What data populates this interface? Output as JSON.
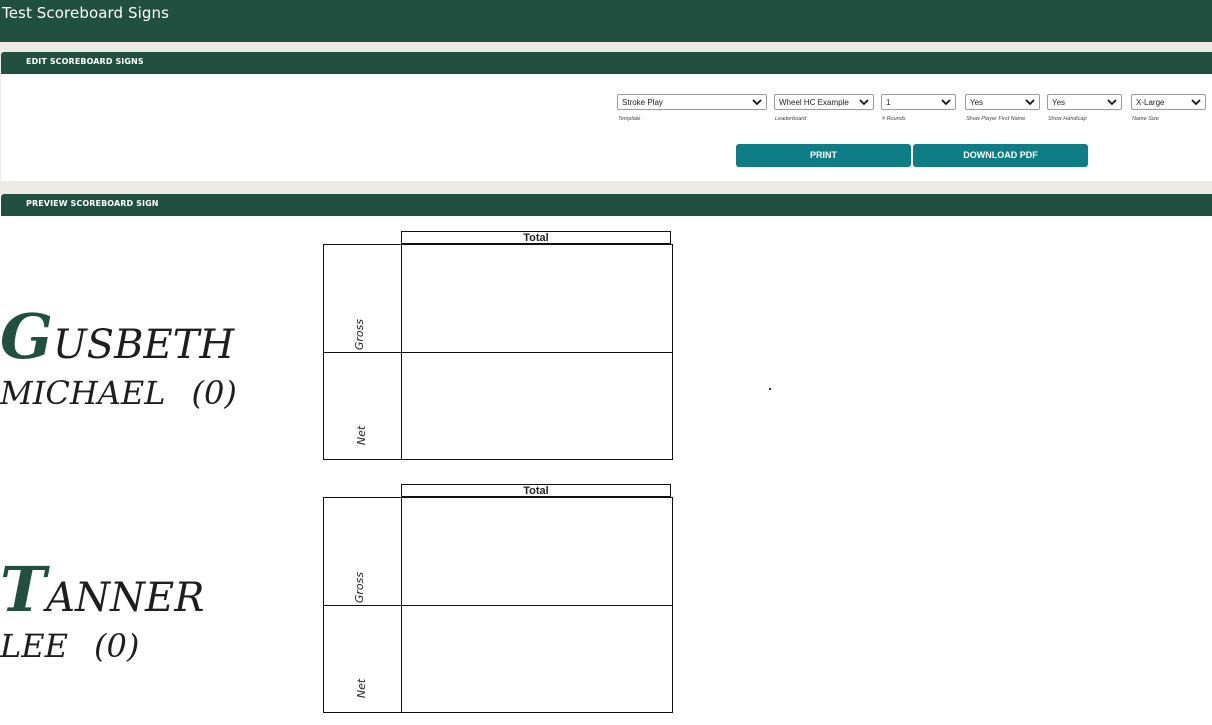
{
  "header": {
    "title": "Test Scoreboard Signs"
  },
  "edit_panel": {
    "title": "EDIT SCOREBOARD SIGNS",
    "selects": [
      {
        "value": "Stroke Play",
        "label": "Template"
      },
      {
        "value": "Wheel HC Example",
        "label": "Leaderboard"
      },
      {
        "value": "1",
        "label": "# Rounds"
      },
      {
        "value": "Yes",
        "label": "Show Player First Name"
      },
      {
        "value": "Yes",
        "label": "Show Handicap"
      },
      {
        "value": "X-Large",
        "label": "Name Size"
      }
    ],
    "print_label": "PRINT",
    "download_label": "DOWNLOAD PDF"
  },
  "preview_panel": {
    "title": "PREVIEW SCOREBOARD SIGN",
    "signs": [
      {
        "last_initial": "G",
        "last_rest": "USBETH",
        "first_name": "MICHAEL",
        "handicap": "(0)",
        "total_header": "Total",
        "gross_label": "Gross",
        "net_label": "Net"
      },
      {
        "last_initial": "T",
        "last_rest": "ANNER",
        "first_name": "LEE",
        "handicap": "(0)",
        "total_header": "Total",
        "gross_label": "Gross",
        "net_label": "Net"
      }
    ]
  },
  "colors": {
    "brand_green": "#214f40",
    "button_teal": "#0f7d86",
    "band_gray": "#ecebe5"
  },
  "icons": {
    "select_chevron": "chevron-down-icon"
  }
}
